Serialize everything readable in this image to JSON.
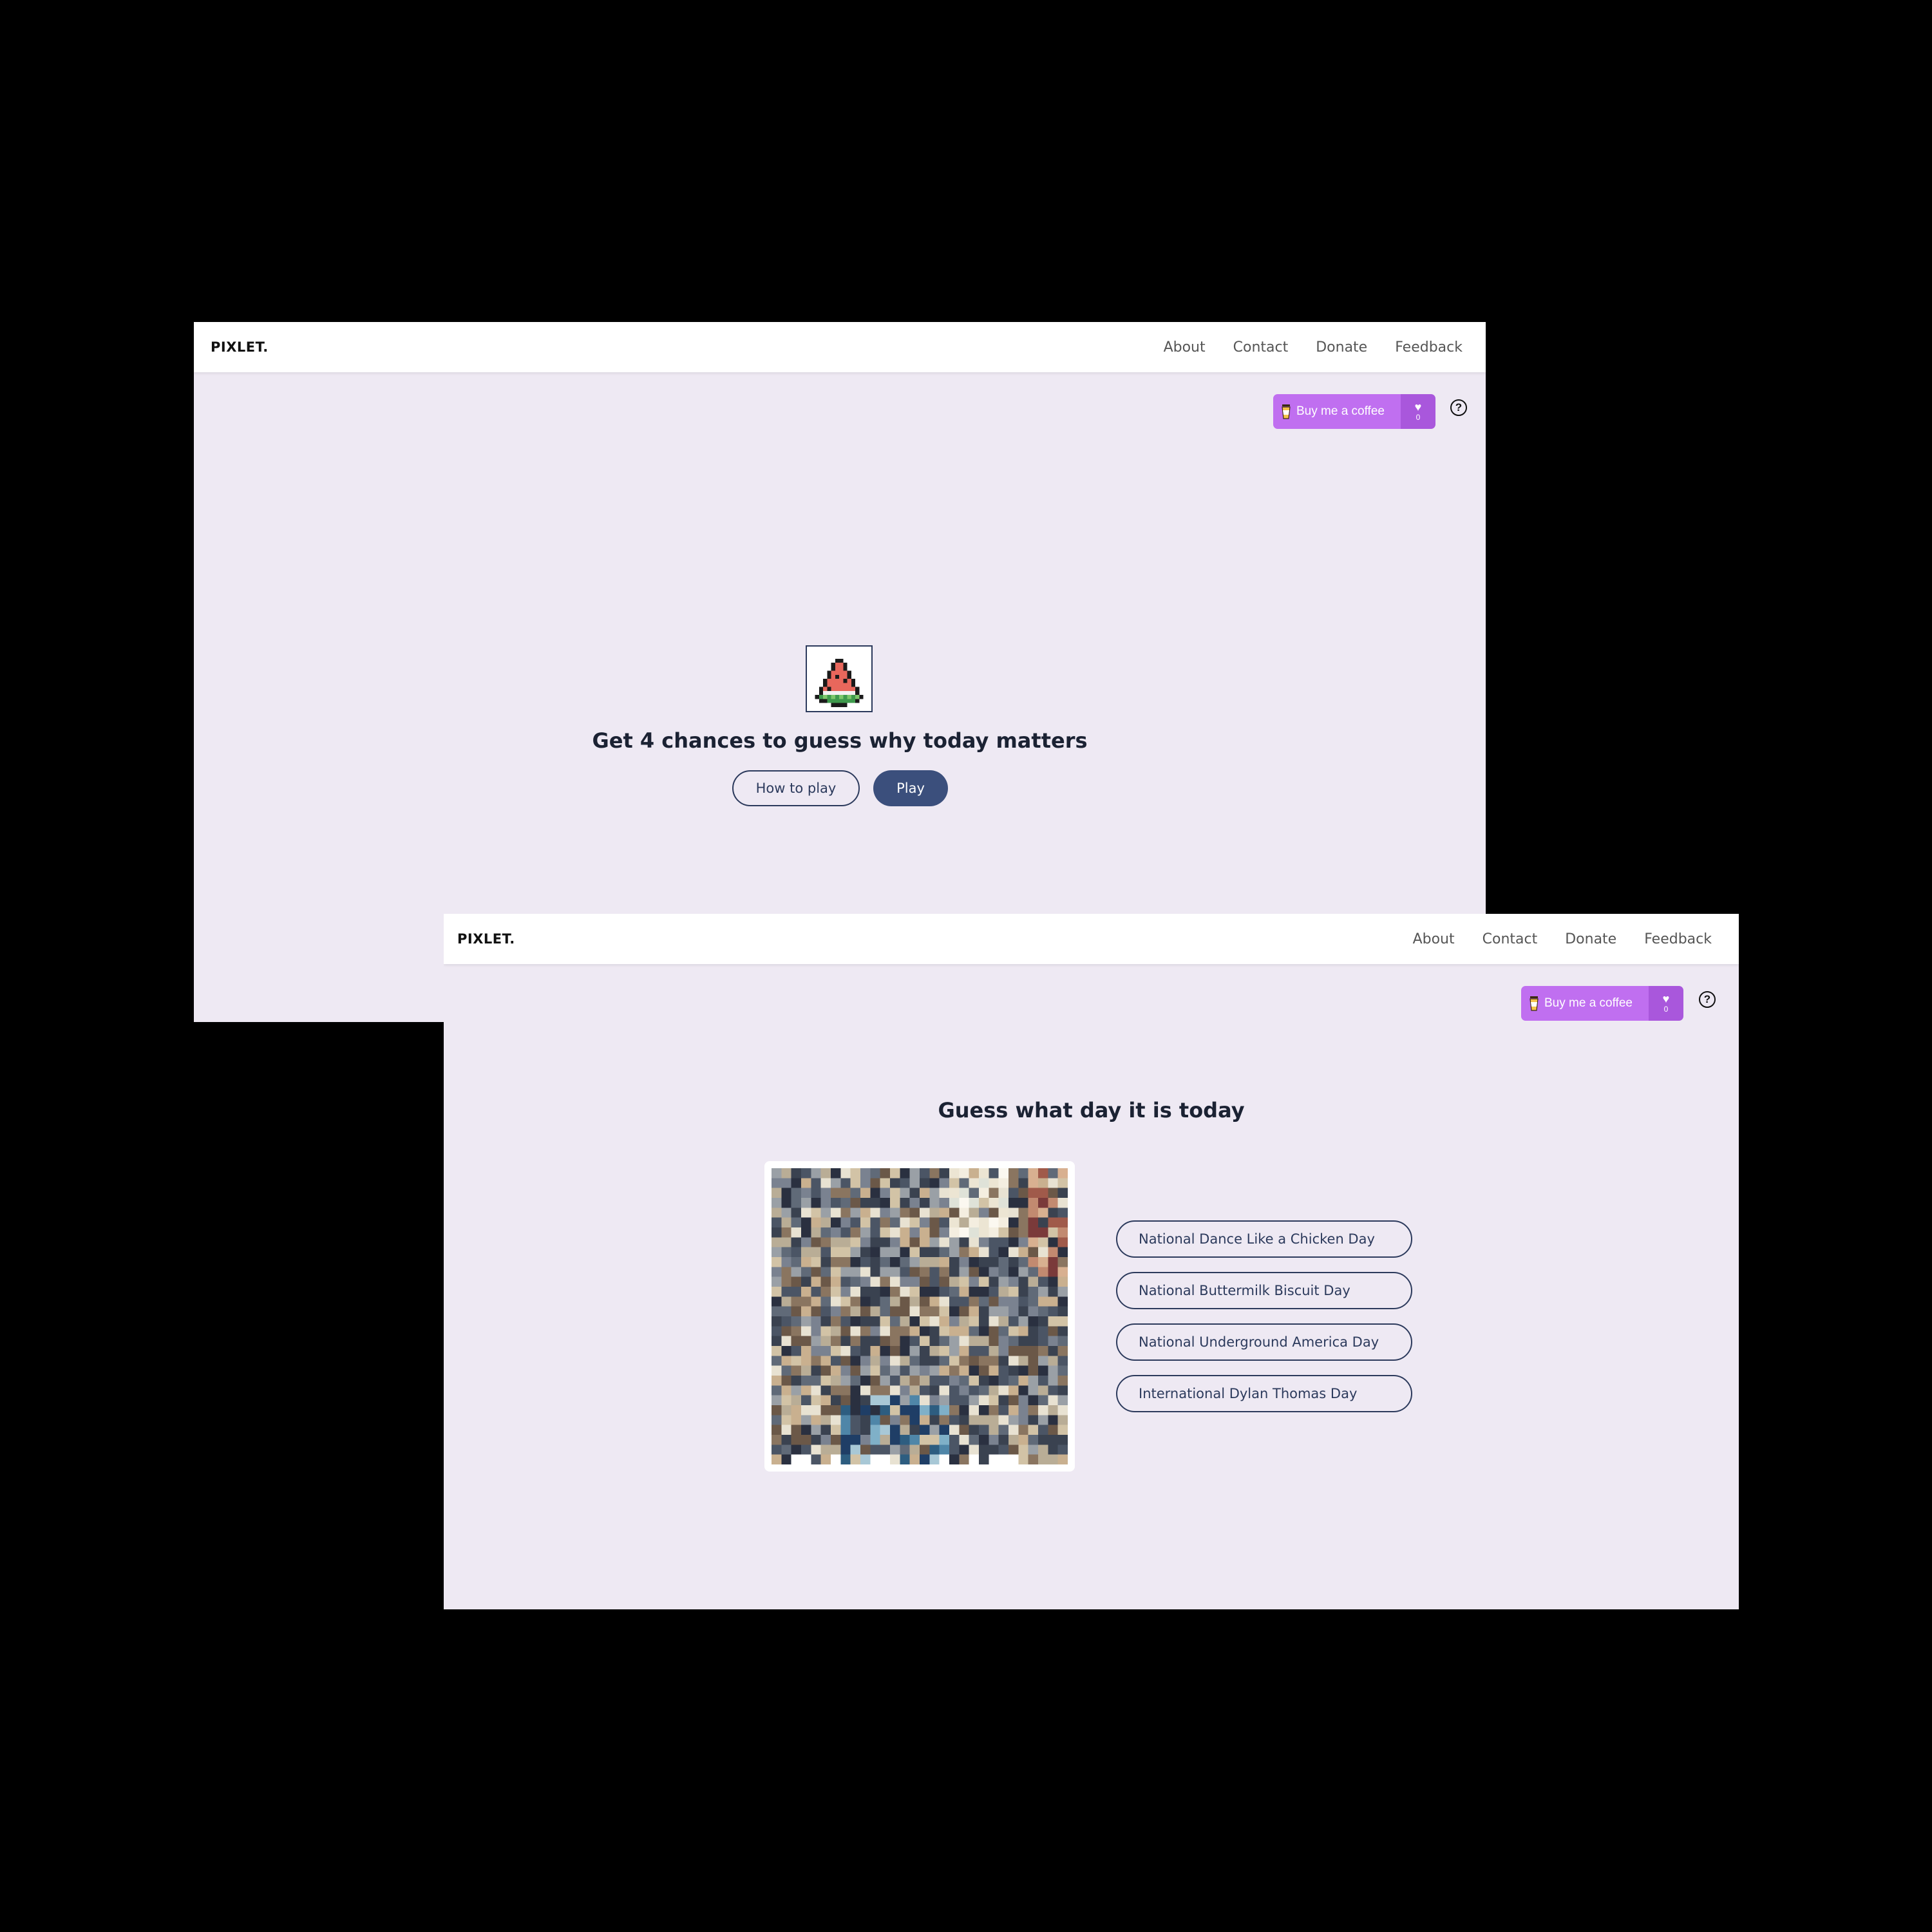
{
  "brand": "PIXLET.",
  "nav": [
    "About",
    "Contact",
    "Donate",
    "Feedback"
  ],
  "coffee": {
    "label": "Buy me a coffee",
    "count": "0",
    "color": "#c06ff0"
  },
  "help_symbol": "?",
  "icons": {
    "heart": "heart-icon",
    "cup": "coffee-cup-icon",
    "help": "help-circle-icon",
    "watermelon": "watermelon-pixel-icon"
  },
  "screen1": {
    "headline": "Get 4 chances to guess why today matters",
    "how_to_play": "How to play",
    "play": "Play"
  },
  "screen2": {
    "headline": "Guess what day it is today",
    "options": [
      "National Dance Like a Chicken Day",
      "National Buttermilk Biscuit Day",
      "National Underground America Day",
      "International Dylan Thomas Day"
    ]
  },
  "colors": {
    "background": "#eee9f3",
    "navy": "#2c3a5c",
    "play_button": "#3b4f7c",
    "coffee_purple": "#c06ff0"
  }
}
